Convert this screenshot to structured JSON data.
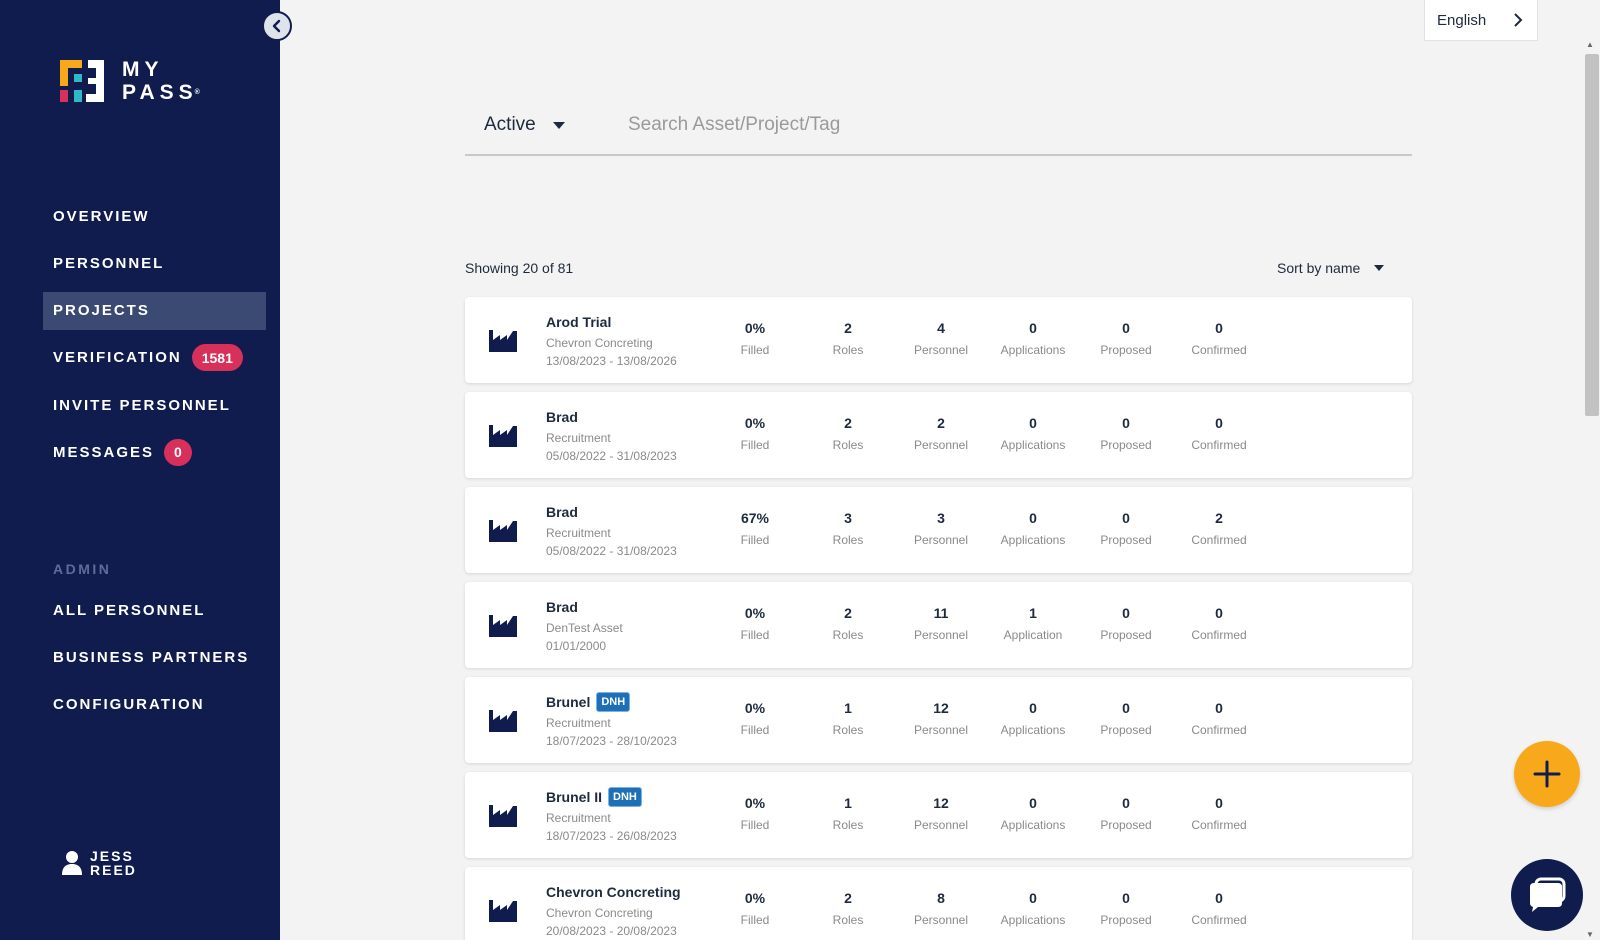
{
  "sidebar": {
    "logo_text_line1": "MY",
    "logo_text_line2": "PASS",
    "logo_mark": "®",
    "nav": [
      {
        "label": "OVERVIEW"
      },
      {
        "label": "PERSONNEL"
      },
      {
        "label": "PROJECTS",
        "active": true
      },
      {
        "label": "VERIFICATION",
        "badge": "1581"
      },
      {
        "label": "INVITE PERSONNEL"
      },
      {
        "label": "MESSAGES",
        "badge": "0"
      }
    ],
    "admin_label": "ADMIN",
    "admin_nav": [
      {
        "label": "ALL PERSONNEL"
      },
      {
        "label": "BUSINESS PARTNERS"
      },
      {
        "label": "CONFIGURATION"
      }
    ],
    "user": {
      "first": "JESS",
      "last": "REED"
    }
  },
  "language": "English",
  "filter": {
    "status": "Active",
    "search_placeholder": "Search Asset/Project/Tag"
  },
  "showing": "Showing 20 of 81",
  "sort_label": "Sort by name",
  "stat_labels": [
    "Filled",
    "Roles",
    "Personnel",
    "Applications",
    "Proposed",
    "Confirmed"
  ],
  "projects": [
    {
      "name": "Arod Trial",
      "tag": "",
      "sub": "Chevron Concreting",
      "dates": "13/08/2023 - 13/08/2026",
      "stats": [
        "0%",
        "2",
        "4",
        "0",
        "0",
        "0"
      ],
      "labels": [
        "Filled",
        "Roles",
        "Personnel",
        "Applications",
        "Proposed",
        "Confirmed"
      ]
    },
    {
      "name": "Brad",
      "tag": "",
      "sub": "Recruitment",
      "dates": "05/08/2022 - 31/08/2023",
      "stats": [
        "0%",
        "2",
        "2",
        "0",
        "0",
        "0"
      ],
      "labels": [
        "Filled",
        "Roles",
        "Personnel",
        "Applications",
        "Proposed",
        "Confirmed"
      ]
    },
    {
      "name": "Brad",
      "tag": "",
      "sub": "Recruitment",
      "dates": "05/08/2022 - 31/08/2023",
      "stats": [
        "67%",
        "3",
        "3",
        "0",
        "0",
        "2"
      ],
      "labels": [
        "Filled",
        "Roles",
        "Personnel",
        "Applications",
        "Proposed",
        "Confirmed"
      ]
    },
    {
      "name": "Brad",
      "tag": "",
      "sub": "DenTest Asset",
      "dates": "01/01/2000",
      "stats": [
        "0%",
        "2",
        "11",
        "1",
        "0",
        "0"
      ],
      "labels": [
        "Filled",
        "Roles",
        "Personnel",
        "Application",
        "Proposed",
        "Confirmed"
      ]
    },
    {
      "name": "Brunel",
      "tag": "DNH",
      "sub": "Recruitment",
      "dates": "18/07/2023 - 28/10/2023",
      "stats": [
        "0%",
        "1",
        "12",
        "0",
        "0",
        "0"
      ],
      "labels": [
        "Filled",
        "Roles",
        "Personnel",
        "Applications",
        "Proposed",
        "Confirmed"
      ]
    },
    {
      "name": "Brunel II",
      "tag": "DNH",
      "sub": "Recruitment",
      "dates": "18/07/2023 - 26/08/2023",
      "stats": [
        "0%",
        "1",
        "12",
        "0",
        "0",
        "0"
      ],
      "labels": [
        "Filled",
        "Roles",
        "Personnel",
        "Applications",
        "Proposed",
        "Confirmed"
      ]
    },
    {
      "name": "Chevron Concreting",
      "tag": "",
      "sub": "Chevron Concreting",
      "dates": "20/08/2023 - 20/08/2023",
      "stats": [
        "0%",
        "2",
        "8",
        "0",
        "0",
        "0"
      ],
      "labels": [
        "Filled",
        "Roles",
        "Personnel",
        "Applications",
        "Proposed",
        "Confirmed"
      ]
    }
  ],
  "colors": {
    "sidebar_bg": "#101c4d",
    "badge": "#d7305a",
    "fab_add": "#f7a81b",
    "tag": "#1e6fb6"
  },
  "icons": {
    "collapse": "chevron-left-icon",
    "language_arrow": "chevron-right-icon",
    "project": "factory-icon",
    "user": "user-icon",
    "add": "plus-icon",
    "chat": "chat-icon"
  }
}
